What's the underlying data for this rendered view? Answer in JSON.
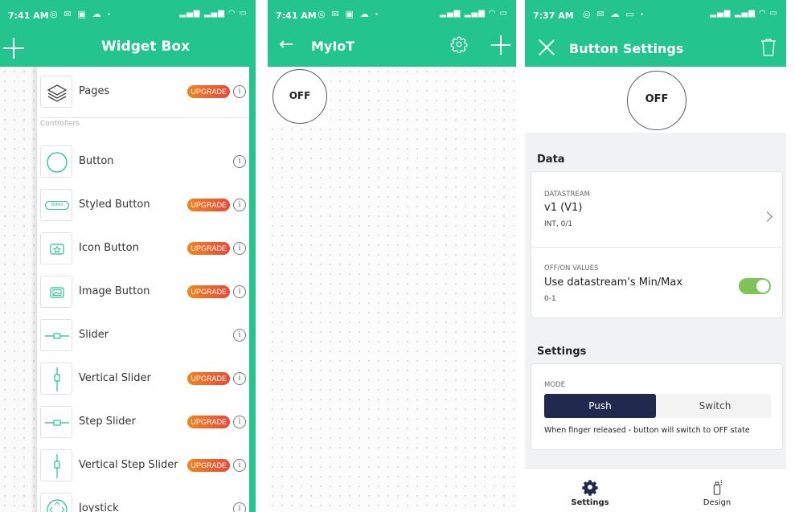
{
  "panel1": {
    "status": {
      "time": "7:41 AM"
    },
    "title": "Widget Box",
    "section": "Controllers",
    "upgrade_label": "UPGRADE",
    "info_glyph": "i",
    "items": [
      {
        "label": "Pages",
        "icon": "layers-icon",
        "upgrade": true
      },
      {
        "label": "Button",
        "icon": "circle-icon",
        "upgrade": false
      },
      {
        "label": "Styled Button",
        "icon": "styled-button-icon",
        "upgrade": true,
        "icon_text": "Button"
      },
      {
        "label": "Icon Button",
        "icon": "star-button-icon",
        "upgrade": true
      },
      {
        "label": "Image Button",
        "icon": "image-button-icon",
        "upgrade": true
      },
      {
        "label": "Slider",
        "icon": "slider-icon",
        "upgrade": false
      },
      {
        "label": "Vertical Slider",
        "icon": "vertical-slider-icon",
        "upgrade": true
      },
      {
        "label": "Step Slider",
        "icon": "step-slider-icon",
        "upgrade": true
      },
      {
        "label": "Vertical Step Slider",
        "icon": "vertical-step-slider-icon",
        "upgrade": true
      },
      {
        "label": "Joystick",
        "icon": "joystick-icon",
        "upgrade": false
      }
    ]
  },
  "panel2": {
    "status": {
      "time": "7:41 AM"
    },
    "title": "MyIoT",
    "widget_label": "OFF"
  },
  "panel3": {
    "status": {
      "time": "7:37 AM"
    },
    "title": "Button Settings",
    "preview_label": "OFF",
    "data_title": "Data",
    "datastream": {
      "caption": "DATASTREAM",
      "value": "v1 (V1)",
      "sub": "INT, 0/1"
    },
    "offon": {
      "caption": "OFF/ON VALUES",
      "value": "Use datastream's Min/Max",
      "sub": "0-1",
      "enabled": true
    },
    "settings_title": "Settings",
    "mode": {
      "caption": "MODE",
      "options": [
        "Push",
        "Switch"
      ],
      "selected": "Push",
      "hint": "When finger released - button will switch to OFF state"
    },
    "tabs": [
      {
        "label": "Settings",
        "icon": "gear-icon",
        "active": true
      },
      {
        "label": "Design",
        "icon": "spray-can-icon",
        "active": false
      }
    ]
  },
  "colors": {
    "brand": "#23c48e",
    "upgrade_start": "#f1851e",
    "upgrade_end": "#e7493a",
    "push_bg": "#22294f",
    "toggle_on": "#80c35b"
  }
}
